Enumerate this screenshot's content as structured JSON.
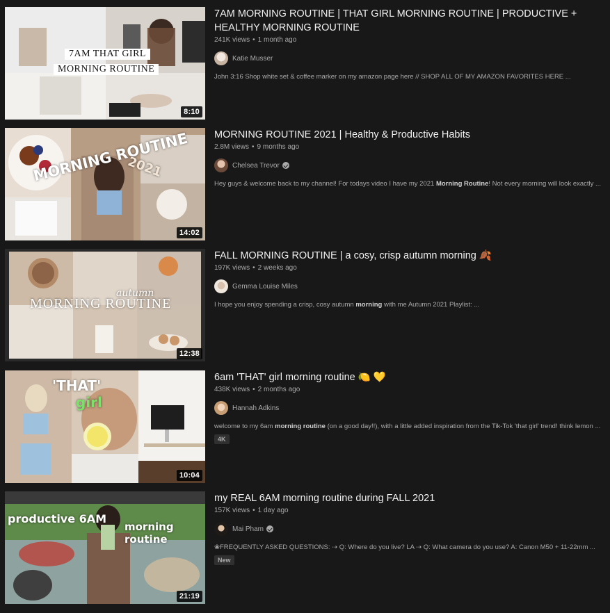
{
  "videos": [
    {
      "title": "7AM MORNING ROUTINE | THAT GIRL MORNING ROUTINE | PRODUCTIVE + HEALTHY MORNING ROUTINE",
      "views": "241K views",
      "age": "1 month ago",
      "channel": "Katie Musser",
      "verified": false,
      "description_before": "John 3:16 Shop white set & coffee marker on my amazon page here // SHOP ALL OF MY AMAZON FAVORITES HERE ...",
      "description_bold": "",
      "description_after": "",
      "duration": "8:10",
      "badge": "",
      "thumb_text_1": "7AM THAT GIRL",
      "thumb_text_2": "MORNING ROUTINE"
    },
    {
      "title": "MORNING ROUTINE 2021 | Healthy & Productive Habits",
      "views": "2.8M views",
      "age": "9 months ago",
      "channel": "Chelsea Trevor",
      "verified": true,
      "description_before": "Hey guys & welcome back to my channel! For todays video I have my 2021 ",
      "description_bold": "Morning Routine",
      "description_after": "! Not every morning will look exactly ...",
      "duration": "14:02",
      "badge": "",
      "thumb_text_1": "MORNING ROUTINE",
      "thumb_text_2": "2021"
    },
    {
      "title": "FALL MORNING ROUTINE | a cosy, crisp autumn morning 🍂",
      "views": "197K views",
      "age": "2 weeks ago",
      "channel": "Gemma Louise Miles",
      "verified": false,
      "description_before": "I hope you enjoy spending a crisp, cosy autumn ",
      "description_bold": "morning",
      "description_after": " with me Autumn 2021 Playlist: ...",
      "duration": "12:38",
      "badge": "",
      "thumb_text_1": "autumn",
      "thumb_text_2": "MORNING ROUTINE"
    },
    {
      "title": "6am 'THAT' girl morning routine 🍋 💛",
      "views": "438K views",
      "age": "2 months ago",
      "channel": "Hannah Adkins",
      "verified": false,
      "description_before": "welcome to my 6am ",
      "description_bold": "morning routine",
      "description_after": " (on a good day!!), with a little added inspiration from the Tik-Tok 'that girl' trend! think lemon ...",
      "duration": "10:04",
      "badge": "4K",
      "thumb_text_1": "'THAT'",
      "thumb_text_2": "girl"
    },
    {
      "title": "my REAL 6AM morning routine during FALL 2021",
      "views": "157K views",
      "age": "1 day ago",
      "channel": "Mai Pham",
      "verified": true,
      "description_before": "❀FREQUENTLY ASKED QUESTIONS: ⇢ Q: Where do you live? LA ⇢ Q: What camera do you use? A: Canon M50 + 11-22mm ...",
      "description_bold": "",
      "description_after": "",
      "duration": "21:19",
      "badge": "New",
      "thumb_text_1": "productive 6AM",
      "thumb_text_2": "morning routine"
    }
  ]
}
